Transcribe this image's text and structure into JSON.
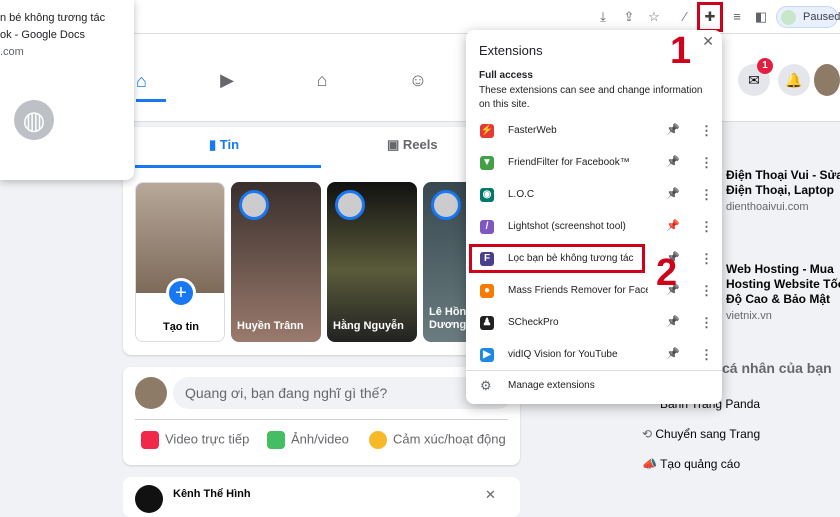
{
  "browser": {
    "paused_label": "Paused"
  },
  "tab_popup": {
    "line1": "n bé không tương tác",
    "line2": "ok - Google Docs",
    "line3": ".com"
  },
  "fb": {
    "stories_tab": "Tin",
    "reels_tab": "Reels",
    "create_story": "Tạo tin",
    "stories": [
      {
        "name": "Huyền Trânn"
      },
      {
        "name": "Hằng Nguyễn"
      },
      {
        "name": "Lê Hồn Dương"
      }
    ],
    "post_placeholder": "Quang ơi, bạn đang nghĩ gì thế?",
    "post_actions": [
      "Video trực tiếp",
      "Ảnh/video",
      "Cảm xúc/hoạt động"
    ],
    "group_name": "Kênh Thể Hình",
    "messenger_badge": "1"
  },
  "sidebar": {
    "ads": [
      {
        "title": [
          "Điện Thoại Vui - Sửa",
          "Điện Thoại, Laptop"
        ],
        "url": "dienthoaivui.com"
      },
      {
        "title": [
          "Web Hosting - Mua",
          "Hosting Website Tốc",
          "Độ Cao & Bảo Mật"
        ],
        "url": "vietnix.vn"
      }
    ],
    "page_section": "cá nhân của bạn",
    "page_name": "Bánh Tráng Panda",
    "switch": "Chuyển sang Trang",
    "create_ad": "Tạo quảng cáo"
  },
  "extensions": {
    "title": "Extensions",
    "full_access": "Full access",
    "desc": "These extensions can see and change information on this site.",
    "items": [
      {
        "name": "FasterWeb",
        "color": "#e53935",
        "glyph": "⚡",
        "pinned": false
      },
      {
        "name": "FriendFilter for Facebook™",
        "color": "#43a047",
        "glyph": "▼",
        "pinned": false
      },
      {
        "name": "L.O.C",
        "color": "#00796b",
        "glyph": "◉",
        "pinned": false
      },
      {
        "name": "Lightshot (screenshot tool)",
        "color": "#7e57c2",
        "glyph": "/",
        "pinned": true
      },
      {
        "name": "Lọc bạn bè không tương tác",
        "color": "#4a3f8a",
        "glyph": "F",
        "pinned": false
      },
      {
        "name": "Mass Friends Remover for Face...",
        "color": "#f57c00",
        "glyph": "●",
        "pinned": false
      },
      {
        "name": "SCheckPro",
        "color": "#212121",
        "glyph": "♟",
        "pinned": false
      },
      {
        "name": "vidIQ Vision for YouTube",
        "color": "#1e88e5",
        "glyph": "▶",
        "pinned": false
      }
    ],
    "manage": "Manage extensions"
  },
  "annotations": {
    "n1": "1",
    "n2": "2"
  },
  "colors": {
    "fb_blue": "#1877f2",
    "highlight_red": "#d0021b"
  }
}
